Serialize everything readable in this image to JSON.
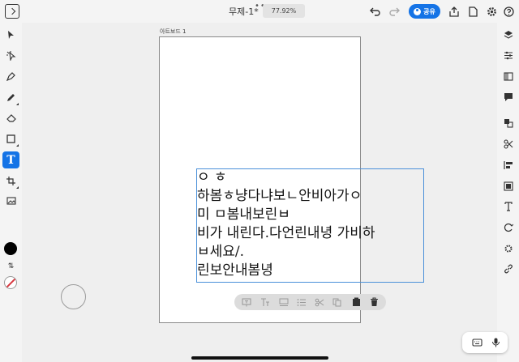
{
  "topbar": {
    "title": "무제-1*",
    "more": "•••",
    "zoom": "77.92%",
    "share_label": "공유",
    "accent": "#1473e6"
  },
  "left_tools": [
    "select-arrow-icon",
    "direct-select-icon",
    "pen-icon",
    "pencil-icon",
    "eraser-icon",
    "shape-icon",
    "type-icon",
    "crop-icon",
    "image-icon"
  ],
  "type_tool_glyph": "T",
  "swap_glyph": "⇅",
  "right_tools": [
    "layers-icon",
    "properties-icon",
    "libraries-icon",
    "comments-icon",
    "arrange-icon",
    "path-icon",
    "align-icon",
    "type-panel-icon",
    "repeat-icon",
    "effects-icon",
    "link-icon"
  ],
  "canvas": {
    "artboard_label": "아트보드 1",
    "text_lines": [
      "ㅇ ㅎ",
      "하봄ㅎ냥다냐보ㄴ안비아가ㅇ",
      "미 ㅁ봄내보린ㅂ",
      "비가 내린다.다언린내녕 가비하",
      "ㅂ세요/.",
      "린보안내봄녕"
    ]
  },
  "floating_toolbar": [
    "text-frame-icon",
    "glyph-size-icon",
    "text-area-icon",
    "list-icon",
    "cut-icon",
    "copy-icon",
    "paste-icon",
    "delete-icon"
  ],
  "keyboard_pill": [
    "keyboard-icon",
    "microphone-icon"
  ]
}
